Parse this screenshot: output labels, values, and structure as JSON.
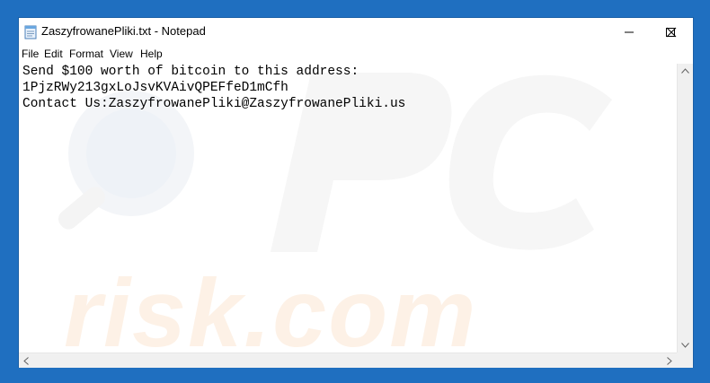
{
  "window": {
    "title": "ZaszyfrowanePliki.txt - Notepad"
  },
  "menu": {
    "items": [
      "File",
      "Edit",
      "Format",
      "View",
      "Help"
    ]
  },
  "editor": {
    "lines": [
      "Send $100 worth of bitcoin to this address:",
      "1PjzRWy213gxLoJsvKVAivQPEFfeD1mCfh",
      "Contact Us:ZaszyfrowanePliki@ZaszyfrowanePliki.us"
    ]
  },
  "watermark": {
    "text": "risk.com"
  },
  "colors": {
    "desktop": "#1f6fc0",
    "window_border": "#1a5fa6"
  },
  "icons": {
    "app": "notepad-icon",
    "minimize": "minimize-icon",
    "maximize": "maximize-icon",
    "close": "close-icon"
  }
}
